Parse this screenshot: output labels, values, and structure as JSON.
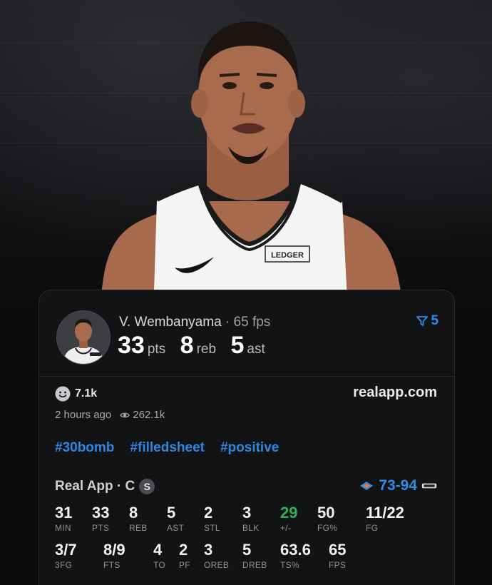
{
  "post": {
    "player_name": "V. Wembanyama",
    "fps_label": " · 65 fps",
    "pts": "33",
    "pts_unit": "pts",
    "reb": "8",
    "reb_unit": "reb",
    "ast": "5",
    "ast_unit": "ast",
    "filter_count": "5",
    "reactions": "7.1k",
    "brand": "realapp.com",
    "time_ago": "2 hours ago",
    "views": "262.1k",
    "tags": [
      "#30bomb",
      "#filledsheet",
      "#positive"
    ]
  },
  "game": {
    "source": "Real App · C",
    "source_badge": "S",
    "score": "73-94"
  },
  "stats_row1": [
    {
      "value": "31",
      "label": "MIN"
    },
    {
      "value": "33",
      "label": "PTS"
    },
    {
      "value": "8",
      "label": "REB"
    },
    {
      "value": "5",
      "label": "AST"
    },
    {
      "value": "2",
      "label": "STL"
    },
    {
      "value": "3",
      "label": "BLK"
    },
    {
      "value": "29",
      "label": "+/-"
    },
    {
      "value": "50",
      "label": "FG%"
    },
    {
      "value": "11/22",
      "label": "FG"
    }
  ],
  "stats_row2": [
    {
      "value": "3/7",
      "label": "3FG"
    },
    {
      "value": "8/9",
      "label": "FTS"
    },
    {
      "value": "4",
      "label": "TO"
    },
    {
      "value": "2",
      "label": "PF"
    },
    {
      "value": "3",
      "label": "OREB"
    },
    {
      "value": "5",
      "label": "DREB"
    },
    {
      "value": "63.6",
      "label": "TS%"
    },
    {
      "value": "65",
      "label": "FPS"
    }
  ],
  "jersey_text": "LEDGER",
  "colors": {
    "accent_blue": "#2f8be6",
    "positive_green": "#30b05a",
    "card_bg": "#121314"
  },
  "icons": {
    "filter": "filter-icon",
    "reaction": "smile-icon",
    "views": "eye-icon"
  }
}
